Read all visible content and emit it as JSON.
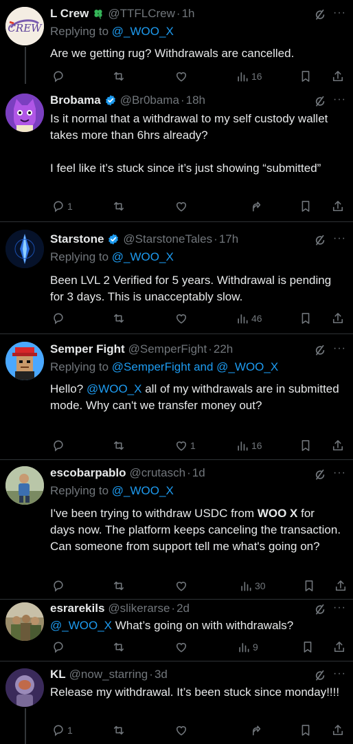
{
  "tweets": [
    {
      "name": "L Crew",
      "handle": "@TTFLCrew",
      "time": "1h",
      "replying_prefix": "Replying to",
      "replying_to": "@_WOO_X",
      "body": "Are we getting rug? Withdrawals are cancelled.",
      "replies": "",
      "likes": "",
      "views": "16"
    },
    {
      "name": "Brobama",
      "handle": "@Br0bama",
      "time": "18h",
      "body_line1": "Is it normal that a withdrawal to my self custody wallet takes more than 6hrs already?",
      "body_line2": "I feel like it’s stuck since it’s just showing “submitted”",
      "replies": "1",
      "likes": "",
      "views": ""
    },
    {
      "name": "Starstone",
      "handle": "@StarstoneTales",
      "time": "17h",
      "replying_prefix": "Replying to",
      "replying_to": "@_WOO_X",
      "body": "Been LVL 2 Verified for 5 years. Withdrawal is pending for 3 days. This is unacceptably slow.",
      "replies": "",
      "likes": "",
      "views": "46"
    },
    {
      "name": "Semper Fight",
      "handle": "@SemperFight",
      "time": "22h",
      "replying_prefix": "Replying to",
      "replying_to": "@SemperFight and @_WOO_X",
      "body_pre": "Hello?",
      "body_mention": "@WOO_X",
      "body_post": " all of my withdrawals are in submitted mode. Why can't we transfer money out?",
      "replies": "",
      "likes": "1",
      "views": "16"
    },
    {
      "name": "escobarpablo",
      "handle": "@crutasch",
      "time": "1d",
      "replying_prefix": "Replying to",
      "replying_to": "@_WOO_X",
      "body_pre": "I've been trying to withdraw USDC from ",
      "body_bold": "WOO X",
      "body_post": " for days now. The platform keeps canceling the transaction. Can someone from support tell me what's going on?",
      "replies": "",
      "likes": "",
      "views": "30"
    },
    {
      "name": "esrarekils",
      "handle": "@slikerarse",
      "time": "2d",
      "body_mention": "@_WOO_X",
      "body_post": " What’s going on with withdrawals?",
      "replies": "",
      "likes": "",
      "views": "9"
    },
    {
      "name": "KL",
      "handle": "@now_starring",
      "time": "3d",
      "body": "Release my withdrawal. It’s been stuck since monday!!!!",
      "replies": "1",
      "likes": "",
      "views": ""
    }
  ],
  "sep": "·",
  "more_glyph": "···",
  "colors": {
    "link": "#1d9bf0",
    "muted": "#71767b",
    "verified": "#1d9bf0",
    "clover": "#35b558"
  }
}
